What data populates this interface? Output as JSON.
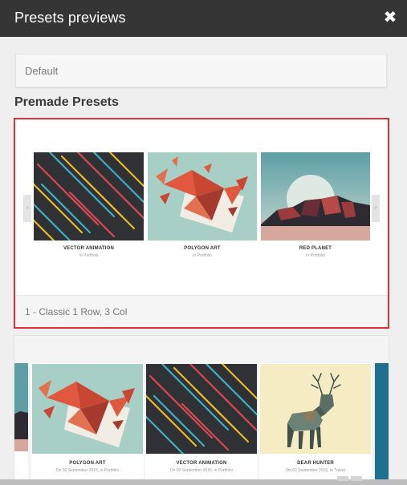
{
  "dialog": {
    "title": "Presets previews",
    "close_icon": "close-icon"
  },
  "default_select": {
    "label": "Default"
  },
  "section": {
    "title": "Premade Presets"
  },
  "selected_preset": {
    "caption": "1 - Classic 1 Row, 3 Col",
    "highlight_color": "#d8323c",
    "items": [
      {
        "name": "VECTOR ANIMATION",
        "sub": "In Portfolio"
      },
      {
        "name": "POLYGON ART",
        "sub": "In Portfolio"
      },
      {
        "name": "RED PLANET",
        "sub": "In Portfolio"
      }
    ],
    "prev_icon": "chevron-left-icon",
    "next_icon": "chevron-right-icon"
  },
  "second_preset": {
    "items": [
      {
        "name": "POLYGON ART",
        "sub": "On 02 September 2015, in Portfolio"
      },
      {
        "name": "VECTOR ANIMATION",
        "sub": "On 02 September 2015, in Portfolio"
      },
      {
        "name": "DEAR HUNTER",
        "sub": "On 02 September 2015, in Travel"
      }
    ]
  }
}
